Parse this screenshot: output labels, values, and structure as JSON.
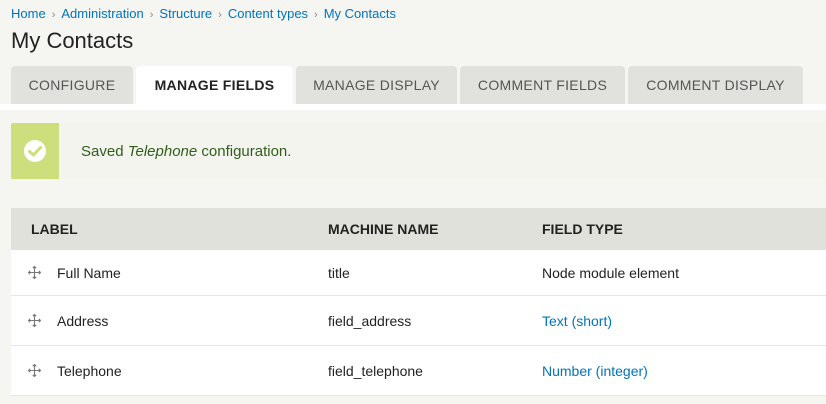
{
  "breadcrumb": {
    "items": [
      "Home",
      "Administration",
      "Structure",
      "Content types",
      "My Contacts"
    ],
    "separator": "›"
  },
  "page_title": "My Contacts",
  "tabs": [
    {
      "label": "CONFIGURE",
      "active": false
    },
    {
      "label": "MANAGE FIELDS",
      "active": true
    },
    {
      "label": "MANAGE DISPLAY",
      "active": false
    },
    {
      "label": "COMMENT FIELDS",
      "active": false
    },
    {
      "label": "COMMENT DISPLAY",
      "active": false
    }
  ],
  "message": {
    "icon": "checkmark-icon",
    "prefix": "Saved ",
    "emphasis": "Telephone",
    "suffix": " configuration."
  },
  "table": {
    "headers": {
      "label": "LABEL",
      "machine_name": "MACHINE NAME",
      "field_type": "FIELD TYPE"
    },
    "rows": [
      {
        "label": "Full Name",
        "machine_name": "title",
        "field_type": "Node module element",
        "type_is_link": false
      },
      {
        "label": "Address",
        "machine_name": "field_address",
        "field_type": "Text (short)",
        "type_is_link": true
      },
      {
        "label": "Telephone",
        "machine_name": "field_telephone",
        "field_type": "Number (integer)",
        "type_is_link": true
      }
    ]
  },
  "colors": {
    "link": "#0074bd",
    "success_accent": "#cdde7c",
    "success_text": "#325e1c"
  }
}
